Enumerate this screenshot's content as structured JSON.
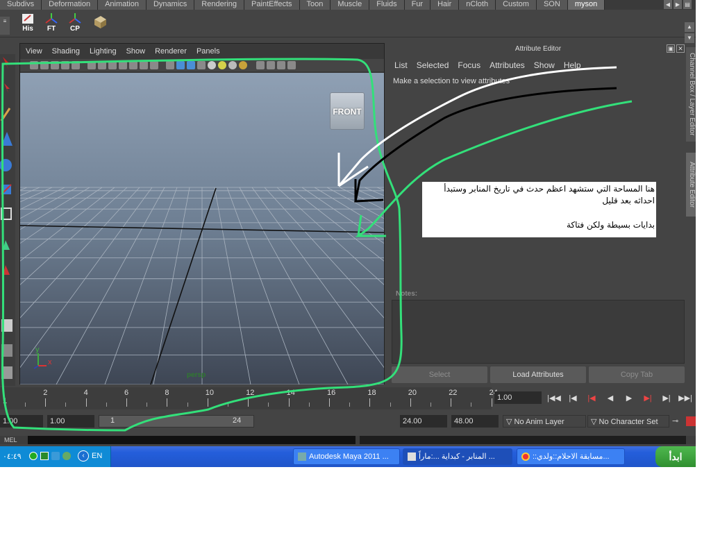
{
  "shelf": {
    "tabs": [
      "Subdivs",
      "Deformation",
      "Animation",
      "Dynamics",
      "Rendering",
      "PaintEffects",
      "Toon",
      "Muscle",
      "Fluids",
      "Fur",
      "Hair",
      "nCloth",
      "Custom",
      "SON",
      "myson"
    ],
    "active_tab": "myson",
    "icons": [
      {
        "label": "His",
        "icon": "history-icon"
      },
      {
        "label": "FT",
        "icon": "freeze-transform-icon"
      },
      {
        "label": "CP",
        "icon": "center-pivot-icon"
      },
      {
        "label": "",
        "icon": "box-icon"
      }
    ]
  },
  "viewport": {
    "menu": [
      "View",
      "Shading",
      "Lighting",
      "Show",
      "Renderer",
      "Panels"
    ],
    "view_cube_label": "FRONT",
    "camera": "persp",
    "axis_y": "y",
    "axis_x": "x"
  },
  "attribute_editor": {
    "title": "Attribute Editor",
    "menu": [
      "List",
      "Selected",
      "Focus",
      "Attributes",
      "Show",
      "Help"
    ],
    "hint": "Make a selection to view attributes",
    "notes_label": "Notes:",
    "buttons": {
      "select": "Select",
      "load": "Load Attributes",
      "copy": "Copy Tab"
    }
  },
  "side_tabs": {
    "channel_box": "Channel Box / Layer Editor",
    "attribute_editor": "Attribute Editor"
  },
  "time_slider": {
    "labels": [
      "2",
      "4",
      "6",
      "8",
      "10",
      "12",
      "14",
      "16",
      "18",
      "20",
      "22",
      "24"
    ],
    "current_frame": "1.00",
    "left_label": "1"
  },
  "range": {
    "start_time": "1.00",
    "playback_start": "1.00",
    "range_start": "1",
    "range_end": "24",
    "playback_end": "24.00",
    "end_time": "48.00",
    "anim_layer": "No Anim Layer",
    "character_set": "No Character Set"
  },
  "command_line": {
    "label": "MEL"
  },
  "taskbar": {
    "start": "ابدأ",
    "tasks": [
      {
        "label": "::مسابقة الاحلام::ولدي...",
        "icon": "chrome-icon"
      },
      {
        "label": "المنابر - كبداية ...:ماراً ...",
        "icon": "document-icon"
      },
      {
        "label": "Autodesk Maya 2011 ...",
        "icon": "maya-icon"
      }
    ],
    "clock": "٠٤:٤٩",
    "language": "EN"
  },
  "annotation": {
    "line1": "هنا المساحة التي ستشهد اعظم حدث في تاريخ المنابر وستبدأ احداثه بعد قليل",
    "line2": "بدايات بسيطة ولكن فتاكة"
  },
  "colors": {
    "maya_bg": "#444444",
    "scene_top": "#8fa0b4",
    "taskbar": "#245edb",
    "green_stroke": "#33e07a"
  }
}
